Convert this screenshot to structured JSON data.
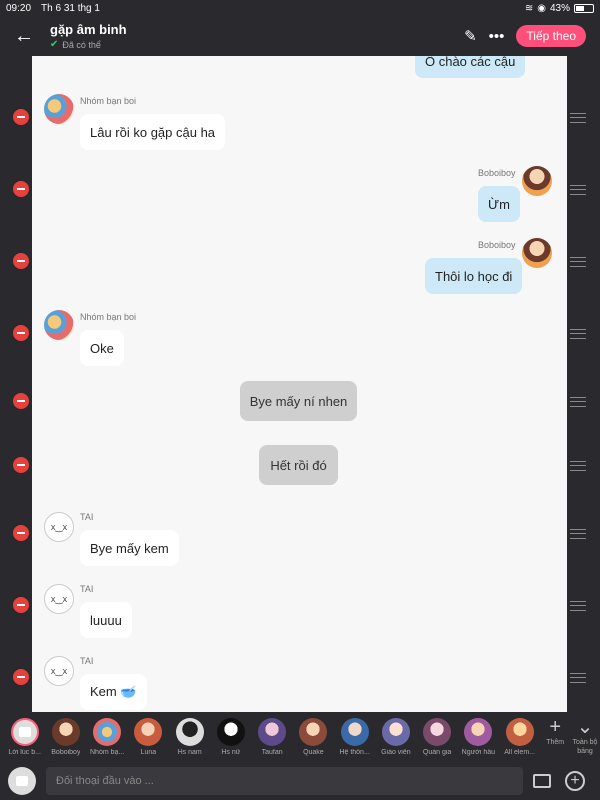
{
  "status": {
    "time": "09:20",
    "date": "Th 6 31 thg 1",
    "battery": "43%"
  },
  "header": {
    "title": "gặp âm binh",
    "subtitle": "Đã có thể",
    "follow_label": "Tiếp theo"
  },
  "messages": [
    {
      "type": "mine",
      "text": "Ô chào các cậu"
    },
    {
      "type": "other",
      "sender": "Nhóm bạn boi",
      "text": "Lâu rồi ko gặp cậu ha"
    },
    {
      "type": "mine",
      "sender": "Boboiboy",
      "text": "Ừm"
    },
    {
      "type": "mine",
      "sender": "Boboiboy",
      "text": "Thôi lo học đi"
    },
    {
      "type": "other",
      "sender": "Nhóm bạn boi",
      "text": "Oke"
    },
    {
      "type": "center",
      "text": "Bye mấy ní nhen"
    },
    {
      "type": "center",
      "text": "Hết rồi đó"
    },
    {
      "type": "other",
      "sender": "TAI",
      "text": "Bye mấy kem"
    },
    {
      "type": "other",
      "sender": "TAI",
      "text": "luuuu"
    },
    {
      "type": "other",
      "sender": "TAI",
      "text": "Kem 🥣"
    }
  ],
  "contacts": [
    {
      "name": "Lời lúc b..."
    },
    {
      "name": "Boboiboy"
    },
    {
      "name": "Nhóm bạ..."
    },
    {
      "name": "Luna"
    },
    {
      "name": "Hs nam"
    },
    {
      "name": "Hs nữ"
    },
    {
      "name": "Taufan"
    },
    {
      "name": "Quake"
    },
    {
      "name": "Hệ thốn..."
    },
    {
      "name": "Giáo viên"
    },
    {
      "name": "Quản gia"
    },
    {
      "name": "Người hầu"
    },
    {
      "name": "All elem..."
    }
  ],
  "strip_actions": {
    "add_label": "Thêm",
    "all_label": "Toàn bộ bảng"
  },
  "input": {
    "placeholder": "Đối thoại đầu vào ..."
  },
  "icons": {
    "back": "back-arrow-icon",
    "edit": "pencil-icon",
    "more": "more-dots-icon",
    "remove": "remove-icon",
    "drag": "drag-handle-icon",
    "image": "image-icon",
    "add": "add-circle-icon"
  },
  "colors": {
    "accent": "#ff4f7b",
    "mine_bubble": "#cde9f7",
    "remove": "#e8403c"
  }
}
